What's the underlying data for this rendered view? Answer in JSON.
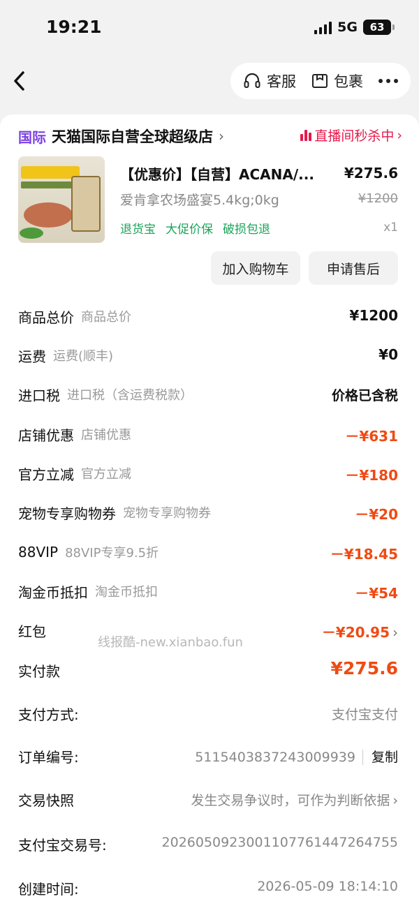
{
  "status": {
    "time": "19:21",
    "network": "5G",
    "battery": "63"
  },
  "nav": {
    "service": "客服",
    "package": "包裹"
  },
  "store": {
    "badge": "国际",
    "name": "天猫国际自营全球超级店",
    "live": "直播间秒杀中"
  },
  "product": {
    "title": "【优惠价】【自营】ACANA/...",
    "price": "¥275.6",
    "spec": "爱肯拿农场盛宴5.4kg;0kg",
    "orig_price": "¥1200",
    "tags": [
      "退货宝",
      "大促价保",
      "破损包退"
    ],
    "qty": "x1"
  },
  "buttons": {
    "cart": "加入购物车",
    "after_sale": "申请售后"
  },
  "rows": [
    {
      "label": "商品总价",
      "sub": "商品总价",
      "value": "¥1200"
    },
    {
      "label": "运费",
      "sub": "运费(顺丰)",
      "value": "¥0"
    },
    {
      "label": "进口税",
      "sub": "进口税（含运费税款）",
      "value": "价格已含税"
    },
    {
      "label": "店铺优惠",
      "sub": "店铺优惠",
      "value": "－¥631"
    },
    {
      "label": "官方立减",
      "sub": "官方立减",
      "value": "－¥180"
    },
    {
      "label": "宠物专享购物券",
      "sub": "宠物专享购物券",
      "value": "－¥20"
    },
    {
      "label": "88VIP",
      "sub": "88VIP专享9.5折",
      "value": "－¥18.45"
    },
    {
      "label": "淘金币抵扣",
      "sub": "淘金币抵扣",
      "value": "－¥54"
    },
    {
      "label": "红包",
      "sub": "",
      "value": "－¥20.95"
    },
    {
      "label": "实付款",
      "sub": "",
      "value": "¥275.6"
    }
  ],
  "watermark": "线报酷-new.xianbao.fun",
  "info": {
    "pay_method_label": "支付方式:",
    "pay_method": "支付宝支付",
    "order_no_label": "订单编号:",
    "order_no": "5115403837243009939",
    "copy": "复制",
    "snapshot_label": "交易快照",
    "snapshot": "发生交易争议时，可作为判断依据",
    "alipay_no_label": "支付宝交易号:",
    "alipay_no": "2026050923001107761447264755",
    "created_label": "创建时间:",
    "created": "2026-05-09 18:14:10"
  },
  "colors": {
    "accent": "#f04a13",
    "live": "#e8194b",
    "intl": "#7b3fe4",
    "tag": "#1aa35a"
  }
}
